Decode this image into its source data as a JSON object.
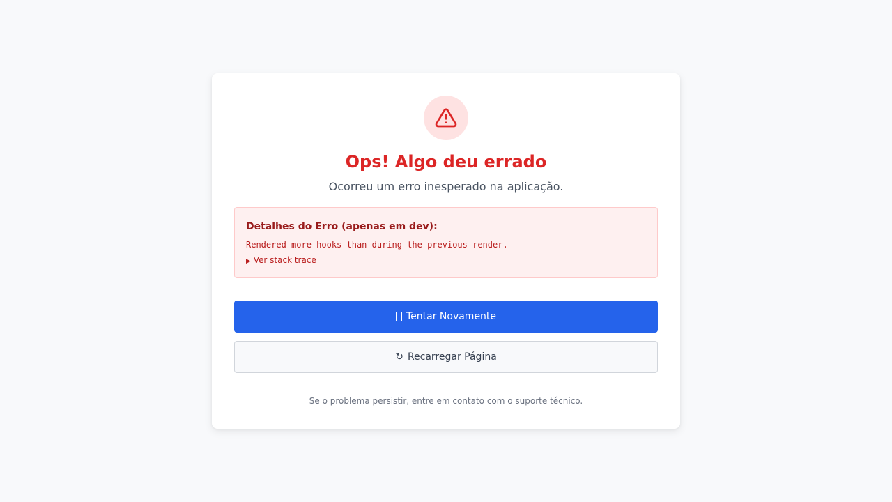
{
  "error_card": {
    "icon": "warning-triangle-icon",
    "title": "Ops! Algo deu errado",
    "subtitle": "Ocorreu um erro inesperado na aplicação.",
    "details": {
      "heading": "Detalhes do Erro (apenas em dev):",
      "message": "Rendered more hooks than during the previous render.",
      "stack_toggle_arrow": "▶",
      "stack_toggle_label": "Ver stack trace"
    },
    "retry_button": {
      "icon_glyph": "",
      "label": "Tentar Novamente"
    },
    "reload_button": {
      "icon_glyph": "↻",
      "label": "Recarregar Página"
    },
    "footer_note": "Se o problema persistir, entre em contato com o suporte técnico."
  },
  "colors": {
    "page_background": "#f8f9fb",
    "error_red": "#dc2626",
    "error_soft_bg": "#fee2e2",
    "primary_blue": "#2563eb"
  }
}
